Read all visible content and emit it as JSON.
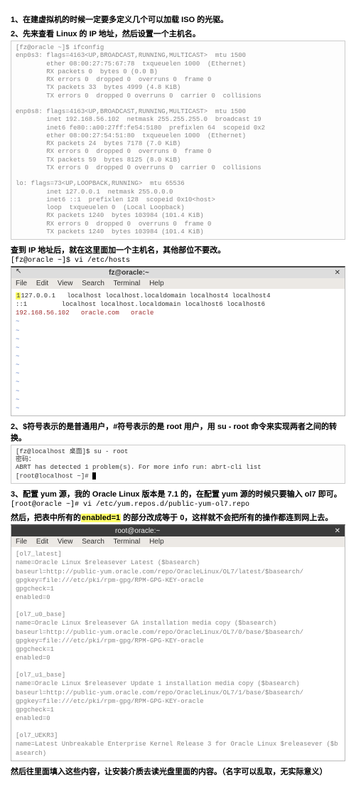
{
  "step1": "1、在建虚拟机的时候一定要多定义几个可以加载 ISO 的光驱。",
  "step2": "2、先来查看 Linux 的 IP 地址，然后设置一个主机名。",
  "ifconfig_block": "[fz@oracle ~]$ ifconfig\nenp0s3: flags=4163<UP,BROADCAST,RUNNING,MULTICAST>  mtu 1500\n        ether 08:00:27:75:67:78  txqueuelen 1000  (Ethernet)\n        RX packets 0  bytes 0 (0.0 B)\n        RX errors 0  dropped 0  overruns 0  frame 0\n        TX packets 33  bytes 4999 (4.8 KiB)\n        TX errors 0  dropped 0 overruns 0  carrier 0  collisions\n\nenp0s8: flags=4163<UP,BROADCAST,RUNNING,MULTICAST>  mtu 1500\n        inet 192.168.56.102  netmask 255.255.255.0  broadcast 19\n        inet6 fe80::a00:27ff:fe54:5180  prefixlen 64  scopeid 0x2\n        ether 08:00:27:54:51:80  txqueuelen 1000  (Ethernet)\n        RX packets 24  bytes 7178 (7.0 KiB)\n        RX errors 0  dropped 0  overruns 0  frame 0\n        TX packets 59  bytes 8125 (8.0 KiB)\n        TX errors 0  dropped 0 overruns 0  carrier 0  collisions\n\nlo: flags=73<UP,LOOPBACK,RUNNING>  mtu 65536\n        inet 127.0.0.1  netmask 255.0.0.0\n        inet6 ::1  prefixlen 128  scopeid 0x10<host>\n        loop  txqueuelen 0  (Local Loopback)\n        RX packets 1240  bytes 103984 (101.4 KiB)\n        RX errors 0  dropped 0  overruns 0  frame 0\n        TX packets 1240  bytes 103984 (101.4 KiB)",
  "step2b": "查到 IP 地址后，就在这里面加一个主机名，其他部位不要改。",
  "cmd_vi_hosts": "[fz@oracle ~]$ vi /etc/hosts",
  "win1": {
    "title": "fz@oracle:~",
    "menu": {
      "file": "File",
      "edit": "Edit",
      "view": "View",
      "search": "Search",
      "terminal": "Terminal",
      "help": "Help"
    },
    "line1": "127.0.0.1   localhost localhost.localdomain localhost4 localhost4",
    "line2": "::1         localhost localhost.localdomain localhost6 localhost6",
    "line3_ip": "192.168.56.102",
    "line3_fqdn": "oracle.com",
    "line3_host": "oracle"
  },
  "step3": "2、$符号表示的是普通用户，#符号表示的是 root 用户，用 su  -  root 命令来实现两者之间的转换。",
  "su_block_l1": "[fz@localhost 桌面]$ su - root",
  "su_block_l2": "密码：",
  "su_block_l3": "ABRT has detected 1 problem(s). For more info run: abrt-cli list",
  "su_block_l4": "[root@localhost ~]#",
  "step4a": "3、配置 yum 源，我的 Oracle Linux 版本是 7.1 的，在配置 yum 源的时候只要输入 ol7 即可。",
  "cmd_vi_repo": "[root@oracle ~]# vi /etc/yum.repos.d/public-yum-ol7.repo",
  "step4b_pre": "然后，把表中所有的",
  "step4b_hl": "enabled=1",
  "step4b_post": " 的部分改成等于 0，这样就不会把所有的操作都连到网上去。",
  "win2": {
    "title": "root@oracle:~",
    "body": "[ol7_latest]\nname=Oracle Linux $releasever Latest ($basearch)\nbaseurl=http://public-yum.oracle.com/repo/OracleLinux/OL7/latest/$basearch/\ngpgkey=file:///etc/pki/rpm-gpg/RPM-GPG-KEY-oracle\ngpgcheck=1\nenabled=0\n\n[ol7_u0_base]\nname=Oracle Linux $releasever GA installation media copy ($basearch)\nbaseurl=http://public-yum.oracle.com/repo/OracleLinux/OL7/0/base/$basearch/\ngpgkey=file:///etc/pki/rpm-gpg/RPM-GPG-KEY-oracle\ngpgcheck=1\nenabled=0\n\n[ol7_u1_base]\nname=Oracle Linux $releasever Update 1 installation media copy ($basearch)\nbaseurl=http://public-yum.oracle.com/repo/OracleLinux/OL7/1/base/$basearch/\ngpgkey=file:///etc/pki/rpm-gpg/RPM-GPG-KEY-oracle\ngpgcheck=1\nenabled=0\n\n[ol7_UEKR3]\nname=Latest Unbreakable Enterprise Kernel Release 3 for Oracle Linux $releasever ($basearch)"
  },
  "step5": "然后往里面填入这些内容，让安装介质去读光盘里面的内容。（名字可以乱取，无实际意义）"
}
